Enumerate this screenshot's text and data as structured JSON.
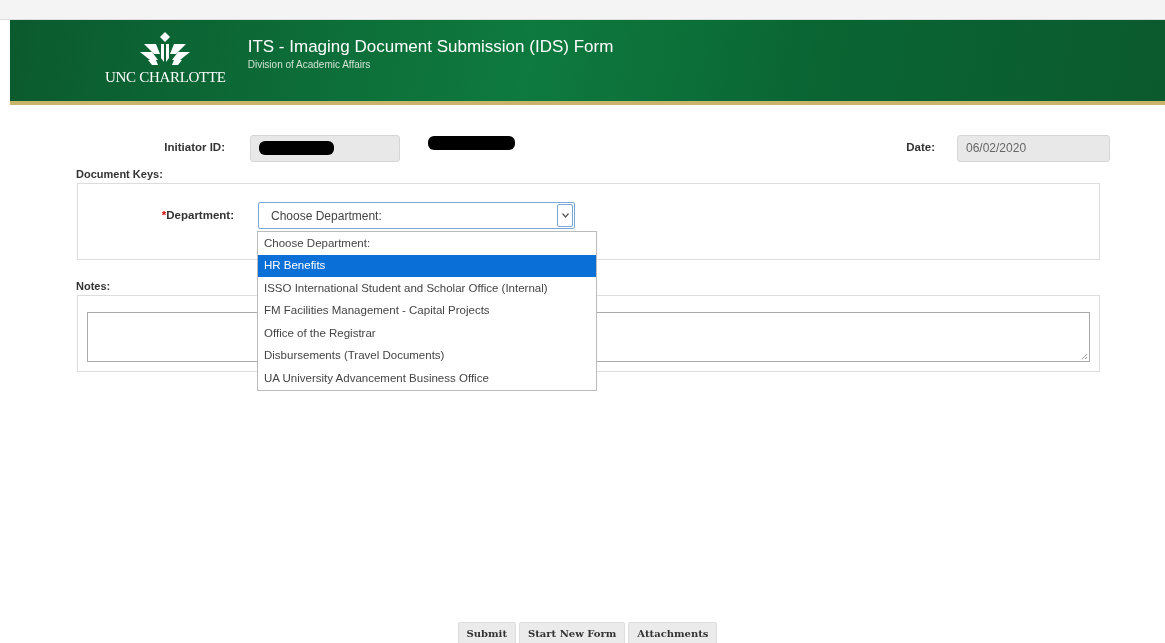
{
  "header": {
    "logo_text": "UNC CHARLOTTE",
    "title": "ITS - Imaging Document Submission (IDS) Form",
    "subtitle": "Division of Academic Affairs"
  },
  "initiator": {
    "label": "Initiator ID:",
    "redacted": true
  },
  "date": {
    "label": "Date:",
    "value": "06/02/2020"
  },
  "document_keys": {
    "legend": "Document Keys:",
    "required_mark": "*",
    "department_label": "Department:",
    "select_value": "Choose Department:",
    "expanded": true,
    "options": [
      {
        "label": "Choose Department:",
        "selected": false
      },
      {
        "label": "HR Benefits",
        "selected": true
      },
      {
        "label": "ISSO International Student and Scholar Office (Internal)",
        "selected": false
      },
      {
        "label": "FM Facilities Management - Capital Projects",
        "selected": false
      },
      {
        "label": "Office of the Registrar",
        "selected": false
      },
      {
        "label": "Disbursements (Travel Documents)",
        "selected": false
      },
      {
        "label": "UA University Advancement Business Office",
        "selected": false
      }
    ]
  },
  "notes": {
    "legend": "Notes:"
  },
  "buttons": [
    "Submit",
    "Start New Form",
    "Attachments"
  ]
}
